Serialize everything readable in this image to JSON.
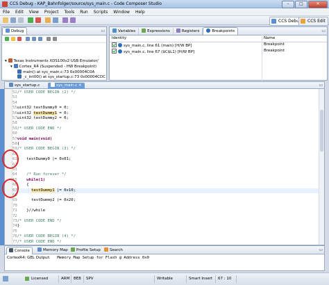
{
  "window": {
    "title": "CCS Debug - KAP_Bahnfolger/source/sys_main.c - Code Composer Studio",
    "buttons": {
      "minimize": "–",
      "maximize": "□",
      "close": "✕"
    }
  },
  "menu": [
    "File",
    "Edit",
    "View",
    "Project",
    "Tools",
    "Run",
    "Scripts",
    "Window",
    "Help"
  ],
  "perspectives": {
    "debug": "CCS Debug",
    "edit": "CCS Edit"
  },
  "debug_view": {
    "tab": "Debug",
    "tree": [
      "Texas Instruments XDS100v2 USB Emulator/",
      "Cortex_R4 (Suspended - HW Breakpoint)",
      "main() at sys_main.c:73 0x00004C0A",
      "_c_int00() at sys_startup.c:73 0x00004CDC"
    ]
  },
  "breakpoints_view": {
    "tabs": [
      "Variables",
      "Expressions",
      "Registers",
      "Breakpoints"
    ],
    "active_tab": "Breakpoints",
    "columns": [
      "Identity",
      "Name"
    ],
    "rows": [
      {
        "identity": "sys_main.c, line 61 (main) [H/W BP]",
        "name": "Breakpoint"
      },
      {
        "identity": "sys_main.c, line 67 ($C$L1) [H/W BP]",
        "name": "Breakpoint"
      }
    ]
  },
  "editor": {
    "tabs": [
      "sys_startup.c",
      "sys_main.c"
    ],
    "active_tab": "sys_main.c",
    "lines": [
      {
        "n": "52",
        "text": "/* USER CODE BEGIN (2) */",
        "type": "cmt"
      },
      {
        "n": "53",
        "text": "",
        "type": "plain"
      },
      {
        "n": "54",
        "text": "",
        "type": "plain"
      },
      {
        "n": "55",
        "text": "uint32 testDummy0 = 0;",
        "type": "plain"
      },
      {
        "n": "56",
        "text": "uint32 testDummy1 = 0;",
        "type": "plain"
      },
      {
        "n": "57",
        "text": "uint32 testDummy2 = 0;",
        "type": "plain"
      },
      {
        "n": "58",
        "text": "",
        "type": "plain"
      },
      {
        "n": "59",
        "text": "/* USER CODE END */",
        "type": "cmt"
      },
      {
        "n": "60",
        "text": "",
        "type": "plain"
      },
      {
        "n": "57",
        "text": "void main(void)",
        "type": "kw"
      },
      {
        "n": "58",
        "text": "{",
        "type": "plain"
      },
      {
        "n": "59",
        "text": "/* USER CODE BEGIN (3) */",
        "type": "cmt"
      },
      {
        "n": "60",
        "text": "",
        "type": "plain"
      },
      {
        "n": "61",
        "text": "    testDummy0 |= 0x01;",
        "type": "plain"
      },
      {
        "n": "62",
        "text": "",
        "type": "plain"
      },
      {
        "n": "63",
        "text": "",
        "type": "plain"
      },
      {
        "n": "64",
        "text": "    /* Run forever */",
        "type": "cmt"
      },
      {
        "n": "65",
        "text": "    while(1)",
        "type": "kw"
      },
      {
        "n": "66",
        "text": "    {",
        "type": "plain"
      },
      {
        "n": "67",
        "text": "      testDummy1 |= 0x10;",
        "type": "plain"
      },
      {
        "n": "68",
        "text": "",
        "type": "plain"
      },
      {
        "n": "69",
        "text": "      testDummy2 |= 0x20;",
        "type": "plain"
      },
      {
        "n": "70",
        "text": "",
        "type": "plain"
      },
      {
        "n": "71",
        "text": "    }//while",
        "type": "plain"
      },
      {
        "n": "72",
        "text": "",
        "type": "plain"
      },
      {
        "n": "73",
        "text": "/* USER CODE END */",
        "type": "cmt"
      },
      {
        "n": "74",
        "text": "}",
        "type": "plain"
      },
      {
        "n": "75",
        "text": "",
        "type": "plain"
      },
      {
        "n": "76",
        "text": "/* USER CODE BEGIN (4) */",
        "type": "cmt"
      },
      {
        "n": "77",
        "text": "/* USER CODE END */",
        "type": "cmt"
      }
    ]
  },
  "console": {
    "tabs": [
      "Console",
      "Memory Map",
      "Profile Setup",
      "Search"
    ],
    "active_tab": "Console",
    "heading": "CortexR4: GEL Output:",
    "message": "Memory Map Setup for Flash @ Address 0x0"
  },
  "status": {
    "license": "Licensed",
    "arch": "ARM",
    "endian": "BE8",
    "fpu": "SPV",
    "mode": "Writable",
    "insert": "Smart Insert",
    "position": "67 : 10"
  },
  "colors": {
    "accent": "#6c9bd6",
    "highlight": "#f7e6a6",
    "annotation_circle": "#d9262b"
  }
}
